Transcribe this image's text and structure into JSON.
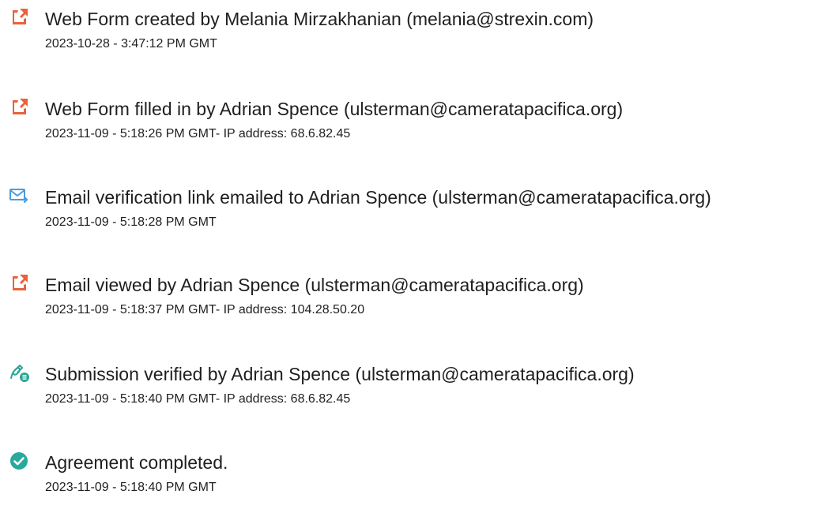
{
  "events": [
    {
      "icon": "document-icon",
      "title": "Web Form created by Melania Mirzakhanian (melania@strexin.com)",
      "meta": "2023-10-28 - 3:47:12 PM GMT"
    },
    {
      "icon": "document-icon",
      "title": "Web Form filled in by Adrian Spence (ulsterman@cameratapacifica.org)",
      "meta": "2023-11-09 - 5:18:26 PM GMT- IP address: 68.6.82.45"
    },
    {
      "icon": "email-send-icon",
      "title": "Email verification link emailed to Adrian Spence (ulsterman@cameratapacifica.org)",
      "meta": "2023-11-09 - 5:18:28 PM GMT"
    },
    {
      "icon": "document-icon",
      "title": "Email viewed by Adrian Spence (ulsterman@cameratapacifica.org)",
      "meta": "2023-11-09 - 5:18:37 PM GMT- IP address: 104.28.50.20"
    },
    {
      "icon": "signature-verified-icon",
      "title": "Submission verified by Adrian Spence (ulsterman@cameratapacifica.org)",
      "meta": "2023-11-09 - 5:18:40 PM GMT- IP address: 68.6.82.45"
    },
    {
      "icon": "check-circle-icon",
      "title": "Agreement completed.",
      "meta": "2023-11-09 - 5:18:40 PM GMT"
    }
  ],
  "colors": {
    "document_icon": "#e8633a",
    "email_icon": "#4a9de0",
    "signature_icon": "#2ba596",
    "check_icon": "#27a99b",
    "text": "#1f1f1f"
  }
}
